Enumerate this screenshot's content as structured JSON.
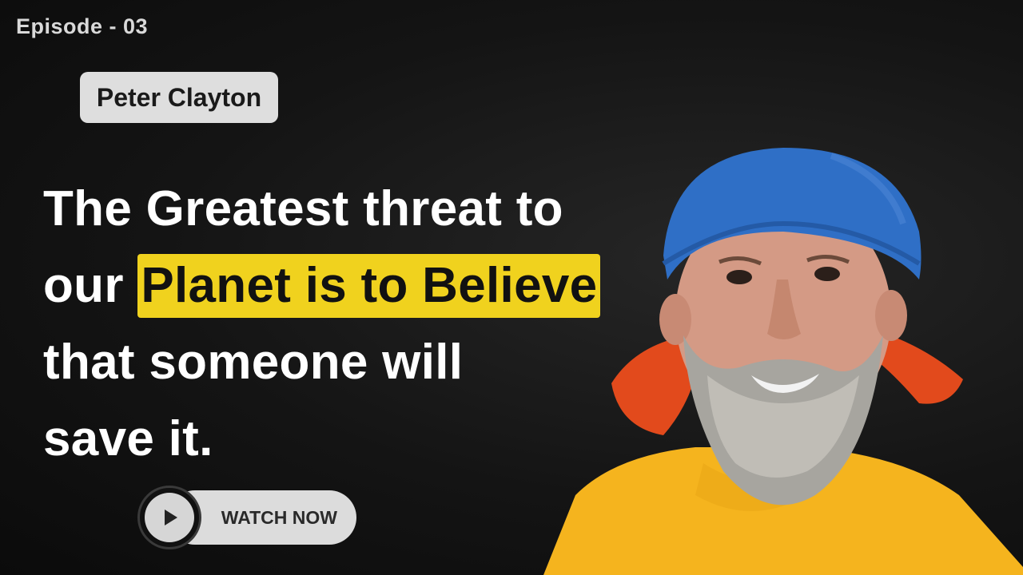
{
  "episode": "Episode - 03",
  "guest_name": "Peter Clayton",
  "headline": {
    "line1": "The Greatest threat to",
    "line2_prefix": "our ",
    "line2_highlight": "Planet is to Believe",
    "line3": "that someone will",
    "line4": "save it."
  },
  "cta": {
    "label": "WATCH NOW",
    "icon": "play-icon"
  },
  "colors": {
    "highlight": "#f0d21e",
    "background": "#141414",
    "bandana": "#2f6fc6",
    "shirt": "#f5b41e"
  }
}
